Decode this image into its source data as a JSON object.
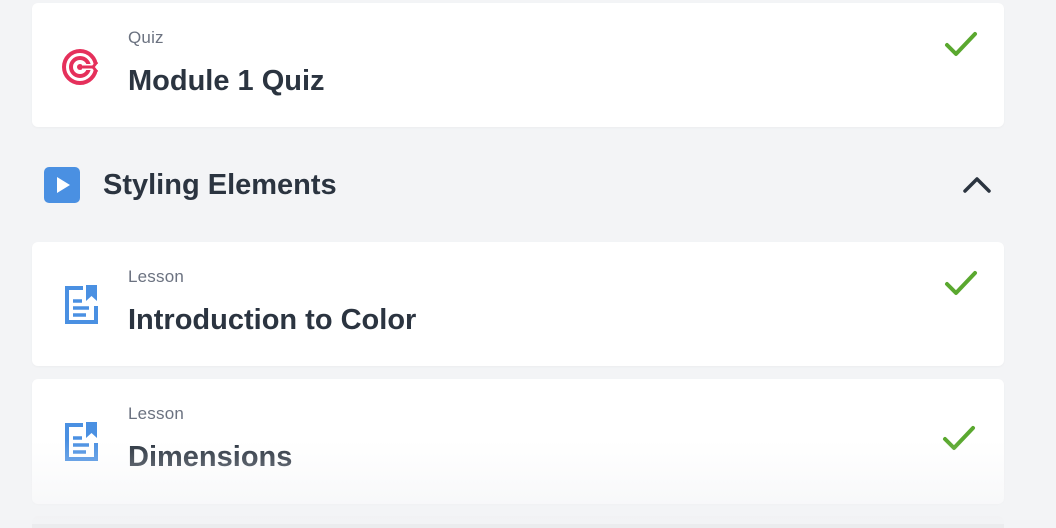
{
  "items": [
    {
      "kind": "Quiz",
      "title": "Module 1 Quiz",
      "icon": "target-icon",
      "icon_color": "#e5305b",
      "completed": true
    },
    {
      "kind": "Lesson",
      "title": "Introduction to Color",
      "icon": "lesson-document-icon",
      "icon_color": "#4a90e2",
      "completed": true
    },
    {
      "kind": "Lesson",
      "title": "Dimensions",
      "icon": "lesson-document-icon",
      "icon_color": "#4a90e2",
      "completed": true
    }
  ],
  "section": {
    "title": "Styling Elements",
    "icon": "play-icon",
    "toggle_icon": "chevron-up-icon",
    "expanded": true
  },
  "colors": {
    "check": "#5aa82f",
    "section_icon": "#4a90e2",
    "text": "#2b3440",
    "muted": "#6b7280",
    "background": "#f3f4f6"
  }
}
